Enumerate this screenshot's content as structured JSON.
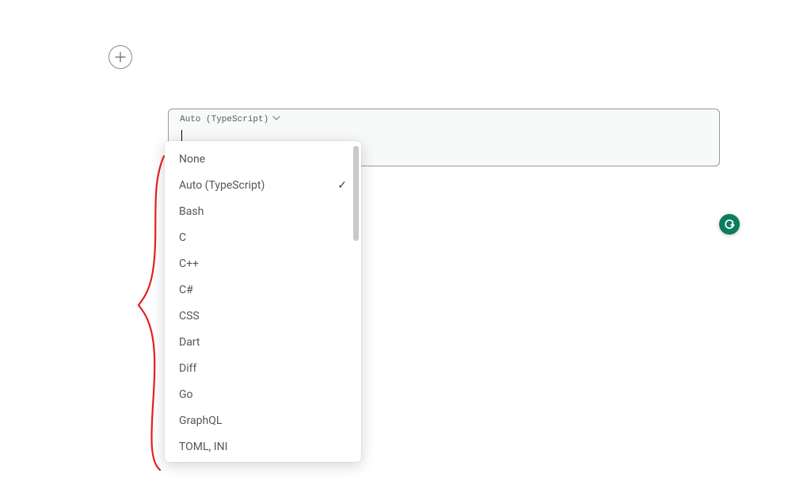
{
  "code_block": {
    "language_label": "Auto (TypeScript)"
  },
  "dropdown": {
    "selected_index": 1,
    "items": [
      {
        "label": "None"
      },
      {
        "label": "Auto (TypeScript)"
      },
      {
        "label": "Bash"
      },
      {
        "label": "C"
      },
      {
        "label": "C++"
      },
      {
        "label": "C#"
      },
      {
        "label": "CSS"
      },
      {
        "label": "Dart"
      },
      {
        "label": "Diff"
      },
      {
        "label": "Go"
      },
      {
        "label": "GraphQL"
      },
      {
        "label": "TOML, INI"
      }
    ]
  },
  "annotation": {
    "stroke_color": "#e62020"
  },
  "badge": {
    "letter": "G"
  }
}
